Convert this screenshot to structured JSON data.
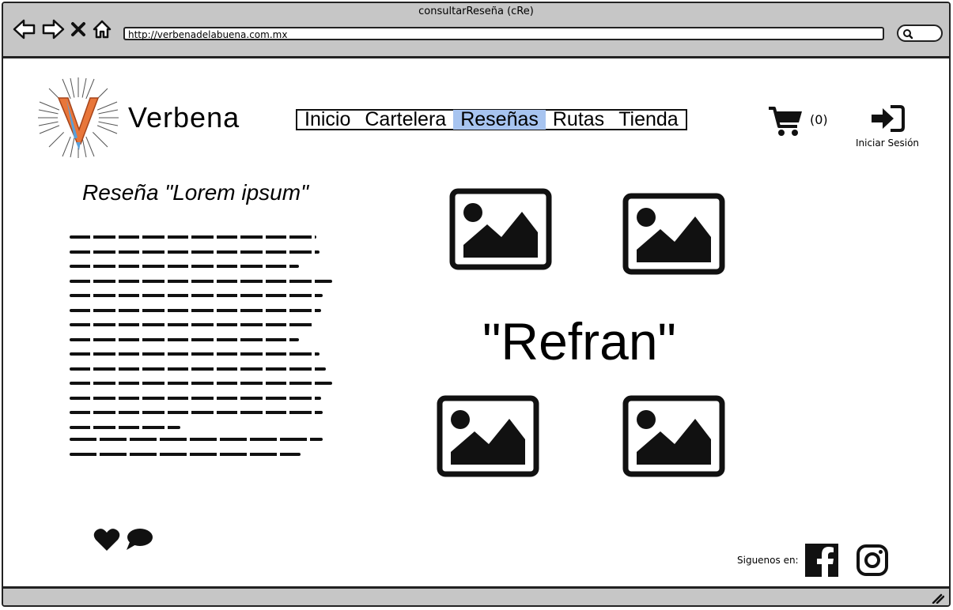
{
  "window": {
    "title": "consultarReseña (cRe)"
  },
  "browser": {
    "url": "http://verbenadelabuena.com.mx",
    "icons": [
      "back-icon",
      "forward-icon",
      "close-icon",
      "home-icon",
      "search-icon",
      "resize-grip-icon"
    ]
  },
  "header": {
    "brand": "Verbena",
    "logo_letter": "V",
    "nav": [
      {
        "label": "Inicio",
        "active": false
      },
      {
        "label": "Cartelera",
        "active": false
      },
      {
        "label": "Reseñas",
        "active": true
      },
      {
        "label": "Rutas",
        "active": false
      },
      {
        "label": "Tienda",
        "active": false
      }
    ],
    "cart_count": "(0)",
    "login_label": "Iniciar Sesión"
  },
  "review": {
    "title": "Reseña \"Lorem ipsum\"",
    "refran": "\"Refran\""
  },
  "footer": {
    "follow_label": "Siguenos en:",
    "social": [
      "facebook-icon",
      "instagram-icon"
    ]
  },
  "colors": {
    "chrome": "#c6c6c6",
    "active_nav": "#a7c4f0",
    "logo_orange": "#e8763a",
    "logo_blue": "#5aa0d8"
  }
}
